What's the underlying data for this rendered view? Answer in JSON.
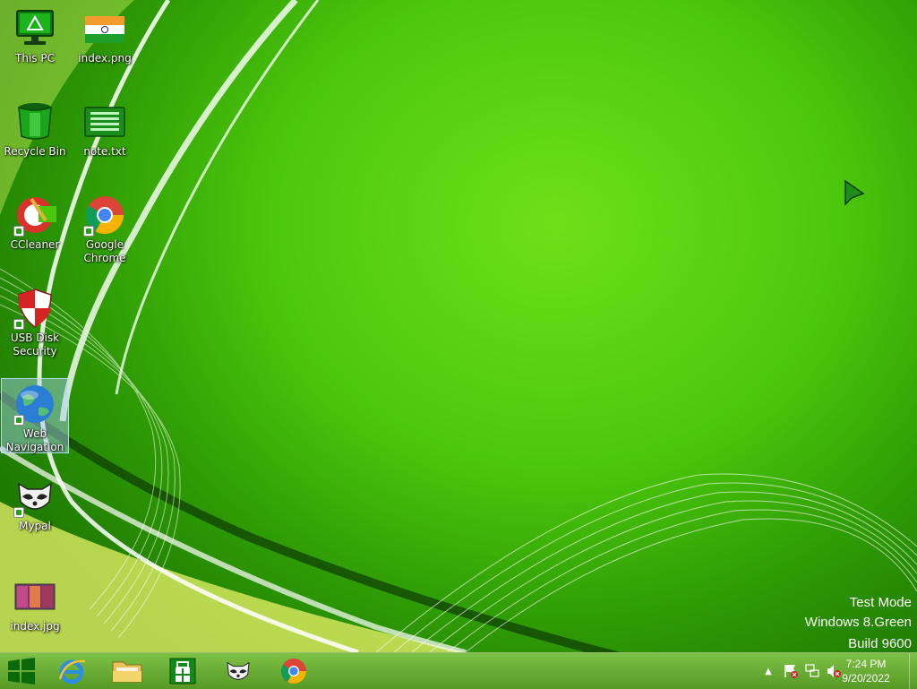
{
  "desktop": {
    "icons": [
      {
        "label": "This PC",
        "icon": "monitor-icon"
      },
      {
        "label": "index.png",
        "icon": "image-flag-icon"
      },
      {
        "label": "Recycle Bin",
        "icon": "recycle-bin-icon"
      },
      {
        "label": "note.txt",
        "icon": "text-file-icon"
      },
      {
        "label": "CCleaner",
        "icon": "ccleaner-icon"
      },
      {
        "label": "Google Chrome",
        "icon": "chrome-icon"
      },
      {
        "label": "USB Disk Security",
        "icon": "shield-icon"
      },
      {
        "label": "Web Navigation",
        "icon": "globe-icon"
      },
      {
        "label": "Mypal",
        "icon": "raccoon-icon"
      },
      {
        "label": "index.jpg",
        "icon": "image-photo-icon"
      }
    ],
    "watermark": {
      "line1": "Test Mode",
      "line2": "Windows 8.Green",
      "line3": "Build 9600"
    }
  },
  "taskbar": {
    "pinned": [
      {
        "name": "start",
        "icon": "windows-logo-icon"
      },
      {
        "name": "internet-explorer",
        "icon": "ie-icon"
      },
      {
        "name": "file-explorer",
        "icon": "folder-icon"
      },
      {
        "name": "store",
        "icon": "store-icon"
      },
      {
        "name": "mypal",
        "icon": "raccoon-icon"
      },
      {
        "name": "chrome",
        "icon": "chrome-icon"
      }
    ],
    "tray": {
      "time": "7:24 PM",
      "date": "9/20/2022"
    }
  },
  "colors": {
    "desktop_green": "#4cc80c",
    "taskbar_green": "#6fb33a"
  }
}
